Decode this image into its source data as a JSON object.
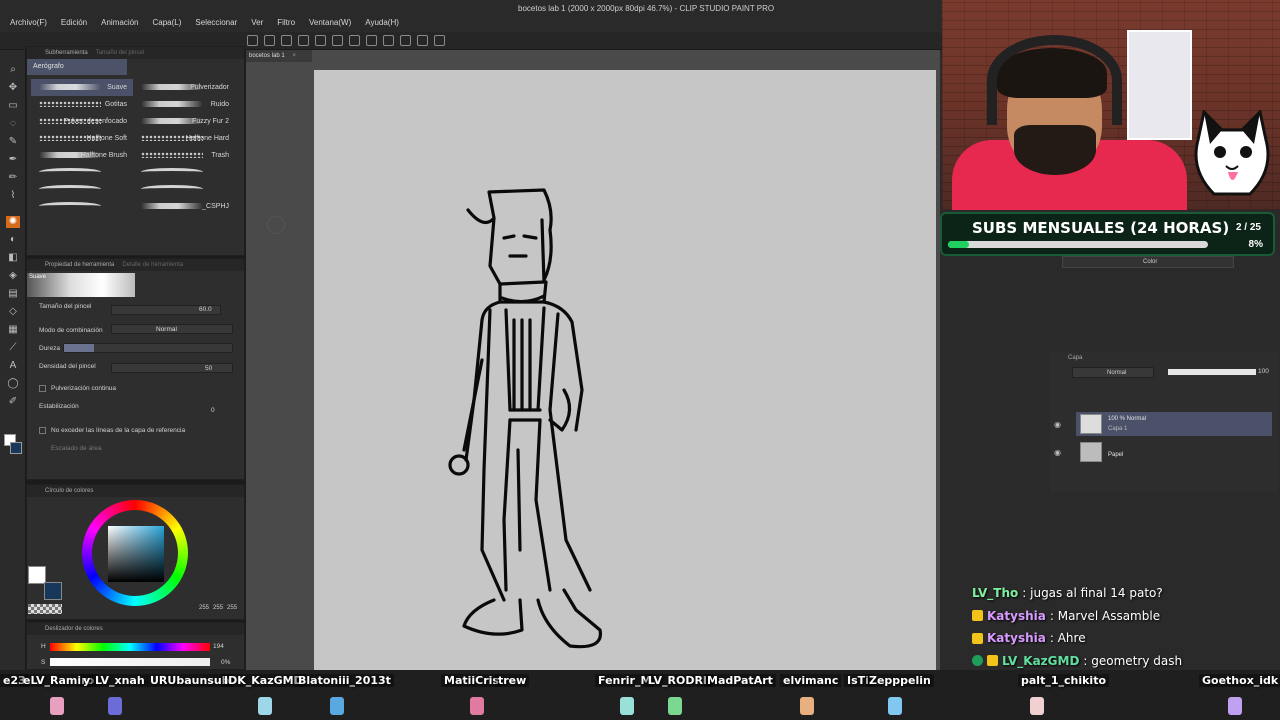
{
  "window": {
    "title": "bocetos lab 1 (2000 x 2000px 80dpi 46.7%) - CLIP STUDIO PAINT PRO"
  },
  "menu": [
    "Archivo(F)",
    "Edición",
    "Animación",
    "Capa(L)",
    "Seleccionar",
    "Ver",
    "Filtro",
    "Ventana(W)",
    "Ayuda(H)"
  ],
  "subtool_panel": {
    "header": "Subherramienta",
    "header_dim": "Tamaño del pincel",
    "active_tab": "Aerógrafo",
    "brushes": [
      [
        "Suave",
        "Pulverizador"
      ],
      [
        "Gotitas",
        "Ruido"
      ],
      [
        "Pulver. desenfocado",
        "Fuzzy Fur 2"
      ],
      [
        "Halftone Soft",
        "Halftone Hard"
      ],
      [
        "Halftone Brush",
        "Trash"
      ],
      [
        "",
        ""
      ],
      [
        "",
        ""
      ],
      [
        "",
        "_CSPHJ"
      ]
    ]
  },
  "tool_property": {
    "header": "Propiedad de herramienta",
    "header_dim": "Detalle de herramienta",
    "preset_name": "Suave",
    "brush_size_label": "Tamaño del pincel",
    "brush_size_value": "60.0",
    "blend_mode_label": "Modo de combinación",
    "blend_mode_value": "Normal",
    "hardness_label": "Dureza",
    "density_label": "Densidad del pincel",
    "density_value": "50",
    "continuous_label": "Pulverización continua",
    "stabilization_label": "Estabilización",
    "stabilization_value": "0",
    "ref_layer_label": "No exceder las líneas de la capa de referencia",
    "area_scale_label": "Escalado de área"
  },
  "color_panel": {
    "header": "Círculo de colores",
    "rgb": [
      "255",
      "255",
      "255"
    ]
  },
  "color_slider": {
    "header": "Deslizador de colores",
    "h_label": "H",
    "h_value": "194",
    "s_label": "S",
    "s_value": "0",
    "s_unit": "%"
  },
  "document": {
    "tab_label": "bocetos lab 1"
  },
  "stream_overlay": {
    "subs_title": "SUBS MENSUALES (24 HORAS)",
    "subs_count": "2 / 25",
    "subs_pct": "8%",
    "progress": 0.08,
    "progress_color": "#1fcf5f"
  },
  "color_mode": {
    "label": "Color"
  },
  "layer_panel": {
    "header": "Capa",
    "blend_mode": "Normal",
    "opacity": "100",
    "layers": [
      {
        "line1": "100 % Normal",
        "line2": "Capa 1"
      },
      {
        "line1": "",
        "line2": "Papel"
      }
    ]
  },
  "chat": [
    {
      "user": "LV_Tho",
      "message": ": jugas al final 14 pato?",
      "badge": false,
      "color": "#7ff0a0"
    },
    {
      "user": "Katyshia",
      "message": ": Marvel Assamble",
      "badge": true,
      "color": "#d89bff"
    },
    {
      "user": "Katyshia",
      "message": ": Ahre",
      "badge": true,
      "color": "#d89bff"
    },
    {
      "user": "LV_KazGMD",
      "message": ": geometry dash",
      "badge": true,
      "color": "#62e0a0"
    }
  ],
  "viewers": [
    "e23",
    "eLV_Ramiro",
    "y",
    "LV_xnah",
    "URUbaunsub",
    "IDK_KazGMD",
    "Blatoniii_2013t",
    "MatiiCris",
    "trew",
    "Fenrir_M",
    "LV_RODRII",
    "MadPatArt",
    "elvimanc",
    "IsTi",
    "Zepppelin",
    "palt_1_chikito",
    "Goethox_idk"
  ]
}
